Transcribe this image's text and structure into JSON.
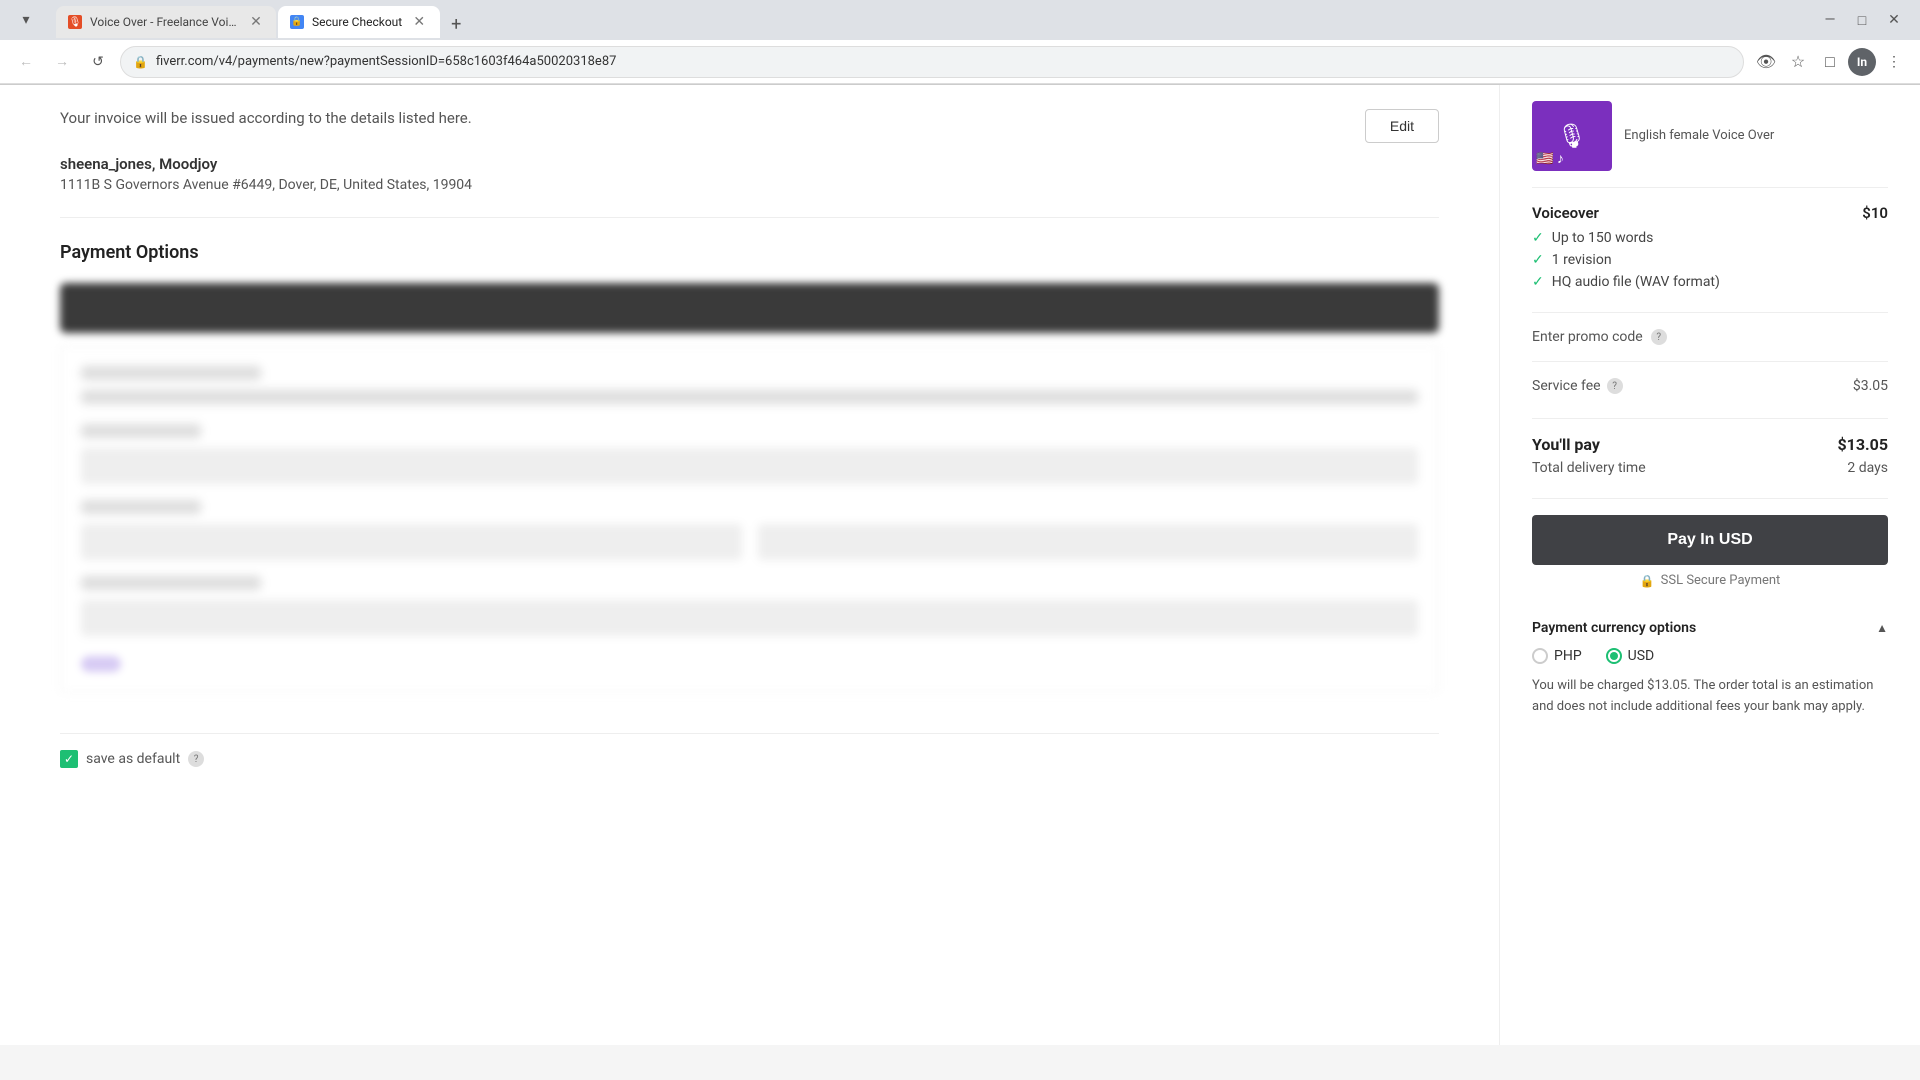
{
  "browser": {
    "tabs": [
      {
        "id": "tab-voiceover",
        "label": "Voice Over - Freelance Voice A...",
        "icon": "🎙",
        "active": false
      },
      {
        "id": "tab-checkout",
        "label": "Secure Checkout",
        "icon": "🔒",
        "active": true
      }
    ],
    "new_tab_label": "+",
    "address": "fiverr.com/v4/payments/new?paymentSessionID=658c1603f464a50020318e87",
    "nav": {
      "back_label": "←",
      "forward_label": "→",
      "reload_label": "↺",
      "minimize_label": "—",
      "maximize_label": "□",
      "close_label": "✕"
    }
  },
  "invoice": {
    "notice": "Your invoice will be issued according to the details listed here.",
    "edit_label": "Edit",
    "name": "sheena_jones, Moodjoy",
    "address": "1111B S Governors Avenue #6449, Dover, DE, United States, 19904"
  },
  "payment": {
    "section_title": "Payment Options"
  },
  "save_default": {
    "label": "save as default",
    "checked": true
  },
  "sidebar": {
    "product_description": "English female Voice Over",
    "voiceover_label": "Voiceover",
    "voiceover_price": "$10",
    "features": [
      {
        "text": "Up to 150 words"
      },
      {
        "text": "1 revision"
      },
      {
        "text": "HQ audio file (WAV format)"
      }
    ],
    "promo_label": "Enter promo code",
    "service_fee_label": "Service fee",
    "service_fee_amount": "$3.05",
    "youll_pay_label": "You'll pay",
    "youll_pay_amount": "$13.05",
    "delivery_label": "Total delivery time",
    "delivery_value": "2 days",
    "pay_btn_label": "Pay In USD",
    "ssl_label": "SSL Secure Payment",
    "currency_title": "Payment currency options",
    "currency_options": [
      {
        "id": "php",
        "label": "PHP",
        "selected": false
      },
      {
        "id": "usd",
        "label": "USD",
        "selected": true
      }
    ],
    "currency_note": "You will be charged $13.05. The order total is an estimation and does not include additional fees your bank may apply."
  }
}
